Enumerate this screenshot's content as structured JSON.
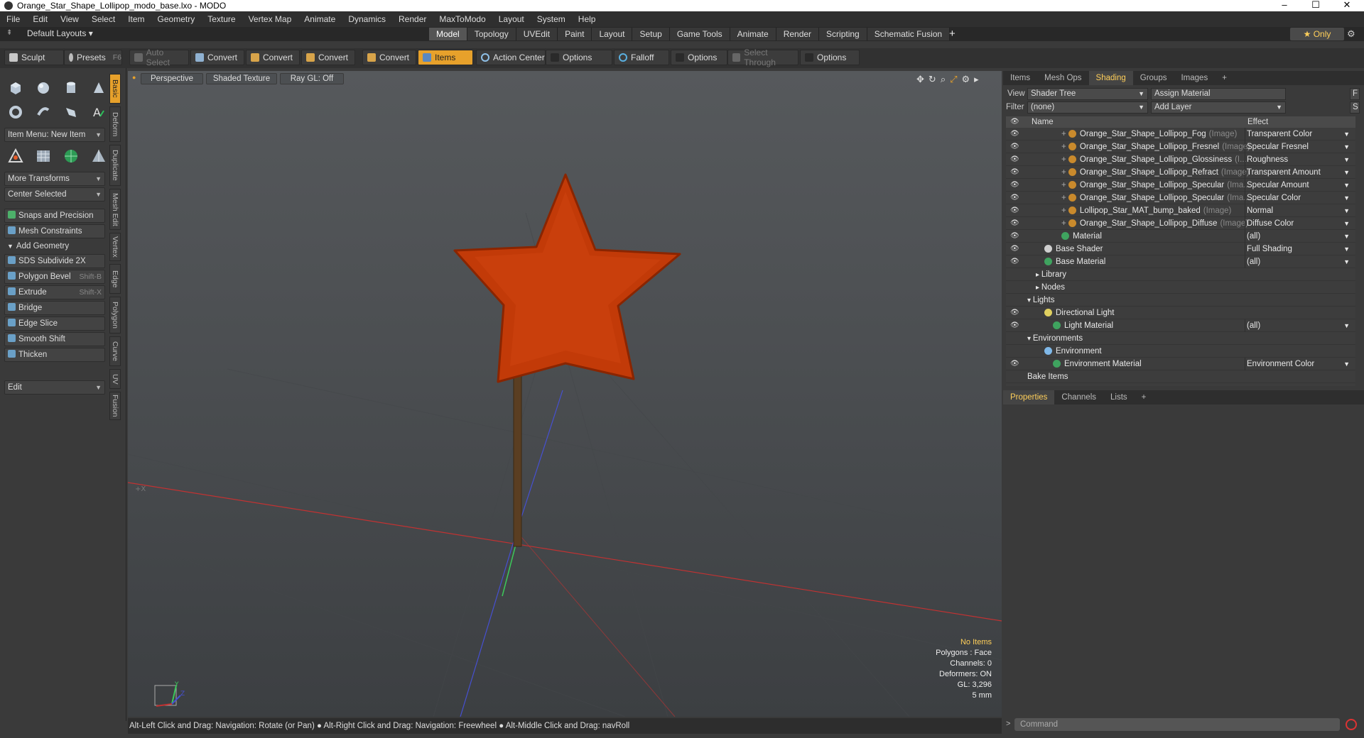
{
  "window": {
    "title": "Orange_Star_Shape_Lollipop_modo_base.lxo - MODO",
    "minimize": "–",
    "maximize": "☐",
    "close": "✕"
  },
  "menu": [
    "File",
    "Edit",
    "View",
    "Select",
    "Item",
    "Geometry",
    "Texture",
    "Vertex Map",
    "Animate",
    "Dynamics",
    "Render",
    "MaxToModo",
    "Layout",
    "System",
    "Help"
  ],
  "layout": {
    "default_layouts": "Default Layouts ▾",
    "tabs": [
      "Model",
      "Topology",
      "UVEdit",
      "Paint",
      "Layout",
      "Setup",
      "Game Tools",
      "Animate",
      "Render",
      "Scripting",
      "Schematic Fusion"
    ],
    "active_tab": "Model",
    "add": "+",
    "only": "★ Only"
  },
  "toolbar": {
    "sculpt": "Sculpt",
    "presets": "Presets",
    "presets_key": "F6",
    "auto_select": "Auto Select",
    "convert": "Convert",
    "items": "Items",
    "action_center": "Action Center",
    "options": "Options",
    "falloff": "Falloff",
    "select_through": "Select Through"
  },
  "left": {
    "item_menu": "Item Menu: New Item",
    "more_transforms": "More Transforms",
    "center_selected": "Center Selected",
    "snaps": "Snaps and Precision",
    "mesh_constraints": "Mesh Constraints",
    "add_geometry": "Add Geometry",
    "tools": [
      {
        "label": "SDS Subdivide 2X",
        "key": ""
      },
      {
        "label": "Polygon Bevel",
        "key": "Shift-B"
      },
      {
        "label": "Extrude",
        "key": "Shift-X"
      },
      {
        "label": "Bridge",
        "key": ""
      },
      {
        "label": "Edge Slice",
        "key": ""
      },
      {
        "label": "Smooth Shift",
        "key": ""
      },
      {
        "label": "Thicken",
        "key": ""
      }
    ],
    "edit": "Edit",
    "vtabs": [
      "Basic",
      "Deform",
      "Duplicate",
      "Mesh Edit",
      "Vertex",
      "Edge",
      "Polygon",
      "Curve",
      "UV",
      "Fusion"
    ]
  },
  "viewport": {
    "perspective": "Perspective",
    "shaded": "Shaded Texture",
    "raygl": "Ray GL: Off",
    "info": {
      "no_items": "No Items",
      "polygons": "Polygons : Face",
      "channels": "Channels: 0",
      "deformers": "Deformers: ON",
      "gl": "GL: 3,296",
      "scale": "5 mm"
    },
    "axis_x": "+X",
    "colors": {
      "star": "#c23a08",
      "stick": "#5a3e22",
      "red_axis": "#c23232",
      "green_axis": "#3cc85a",
      "blue_axis": "#4650d2"
    }
  },
  "status": "Alt-Left Click and Drag: Navigation: Rotate (or Pan) ● Alt-Right Click and Drag: Navigation: Freewheel ● Alt-Middle Click and Drag: navRoll",
  "right": {
    "tabs": [
      "Items",
      "Mesh Ops",
      "Shading",
      "Groups",
      "Images",
      "+"
    ],
    "active_tab": "Shading",
    "view_label": "View",
    "view_value": "Shader Tree",
    "assign_material": "Assign Material",
    "filter_label": "Filter",
    "filter_value": "(none)",
    "add_layer": "Add Layer",
    "f_btn": "F",
    "s_btn": "S",
    "col_name": "Name",
    "col_effect": "Effect",
    "rows": [
      {
        "name": "Orange_Star_Shape_Lollipop_Fog",
        "suffix": "(Image)",
        "effect": "Transparent Color",
        "indent": 4,
        "eye": true,
        "kind": "img"
      },
      {
        "name": "Orange_Star_Shape_Lollipop_Fresnel",
        "suffix": "(Image)",
        "effect": "Specular Fresnel",
        "indent": 4,
        "eye": true,
        "kind": "img"
      },
      {
        "name": "Orange_Star_Shape_Lollipop_Glossiness",
        "suffix": "(I...",
        "effect": "Roughness",
        "indent": 4,
        "eye": true,
        "kind": "img"
      },
      {
        "name": "Orange_Star_Shape_Lollipop_Refract",
        "suffix": "(Image)",
        "effect": "Transparent Amount",
        "indent": 4,
        "eye": true,
        "kind": "img"
      },
      {
        "name": "Orange_Star_Shape_Lollipop_Specular",
        "suffix": "(Ima...",
        "effect": "Specular Amount",
        "indent": 4,
        "eye": true,
        "kind": "img"
      },
      {
        "name": "Orange_Star_Shape_Lollipop_Specular",
        "suffix": "(Ima...",
        "effect": "Specular Color",
        "indent": 4,
        "eye": true,
        "kind": "img"
      },
      {
        "name": "Lollipop_Star_MAT_bump_baked",
        "suffix": "(Image)",
        "effect": "Normal",
        "indent": 4,
        "eye": true,
        "kind": "img"
      },
      {
        "name": "Orange_Star_Shape_Lollipop_Diffuse",
        "suffix": "(Image)",
        "effect": "Diffuse Color",
        "indent": 4,
        "eye": true,
        "kind": "img"
      },
      {
        "name": "Material",
        "suffix": "",
        "effect": "(all)",
        "indent": 4,
        "eye": true,
        "kind": "mat"
      },
      {
        "name": "Base Shader",
        "suffix": "",
        "effect": "Full Shading",
        "indent": 2,
        "eye": true,
        "kind": "shader"
      },
      {
        "name": "Base Material",
        "suffix": "",
        "effect": "(all)",
        "indent": 2,
        "eye": true,
        "kind": "mat"
      },
      {
        "name": "Library",
        "suffix": "",
        "effect": "",
        "indent": 1,
        "eye": false,
        "kind": "folder"
      },
      {
        "name": "Nodes",
        "suffix": "",
        "effect": "",
        "indent": 1,
        "eye": false,
        "kind": "folder"
      },
      {
        "name": "Lights",
        "suffix": "",
        "effect": "",
        "indent": 0,
        "eye": false,
        "kind": "group"
      },
      {
        "name": "Directional Light",
        "suffix": "",
        "effect": "",
        "indent": 2,
        "eye": true,
        "kind": "light"
      },
      {
        "name": "Light Material",
        "suffix": "",
        "effect": "(all)",
        "indent": 3,
        "eye": true,
        "kind": "mat"
      },
      {
        "name": "Environments",
        "suffix": "",
        "effect": "",
        "indent": 0,
        "eye": false,
        "kind": "group"
      },
      {
        "name": "Environment",
        "suffix": "",
        "effect": "",
        "indent": 2,
        "eye": false,
        "kind": "env"
      },
      {
        "name": "Environment Material",
        "suffix": "",
        "effect": "Environment Color",
        "indent": 3,
        "eye": true,
        "kind": "mat"
      },
      {
        "name": "Bake Items",
        "suffix": "",
        "effect": "",
        "indent": 0,
        "eye": false,
        "kind": "plain"
      }
    ],
    "prop_tabs": [
      "Properties",
      "Channels",
      "Lists",
      "+"
    ],
    "prop_active": "Properties"
  },
  "command": {
    "placeholder": "Command"
  }
}
